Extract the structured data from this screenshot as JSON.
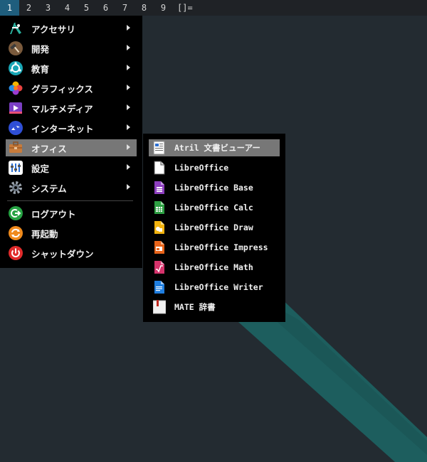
{
  "topbar": {
    "workspaces": [
      "1",
      "2",
      "3",
      "4",
      "5",
      "6",
      "7",
      "8",
      "9"
    ],
    "active_workspace": "1",
    "layout_symbol": "[]="
  },
  "menu": {
    "items": [
      {
        "label": "アクセサリ",
        "icon": "accessories-icon",
        "has_submenu": true
      },
      {
        "label": "開発",
        "icon": "development-hammer-icon",
        "has_submenu": true
      },
      {
        "label": "教育",
        "icon": "education-icon",
        "has_submenu": true
      },
      {
        "label": "グラフィックス",
        "icon": "graphics-icon",
        "has_submenu": true
      },
      {
        "label": "マルチメディア",
        "icon": "multimedia-icon",
        "has_submenu": true
      },
      {
        "label": "インターネット",
        "icon": "internet-icon",
        "has_submenu": true
      },
      {
        "label": "オフィス",
        "icon": "office-briefcase-icon",
        "has_submenu": true,
        "selected": true
      },
      {
        "label": "設定",
        "icon": "settings-icon",
        "has_submenu": true
      },
      {
        "label": "システム",
        "icon": "system-gear-icon",
        "has_submenu": true
      }
    ],
    "session_items": [
      {
        "label": "ログアウト",
        "icon": "logout-icon"
      },
      {
        "label": "再起動",
        "icon": "restart-icon"
      },
      {
        "label": "シャットダウン",
        "icon": "shutdown-icon"
      }
    ]
  },
  "submenu": {
    "items": [
      {
        "label": "Atril 文書ビューアー",
        "icon": "atril-document-viewer-icon",
        "selected": true
      },
      {
        "label": "LibreOffice",
        "icon": "libreoffice-icon"
      },
      {
        "label": "LibreOffice Base",
        "icon": "libreoffice-base-icon"
      },
      {
        "label": "LibreOffice Calc",
        "icon": "libreoffice-calc-icon"
      },
      {
        "label": "LibreOffice Draw",
        "icon": "libreoffice-draw-icon"
      },
      {
        "label": "LibreOffice Impress",
        "icon": "libreoffice-impress-icon"
      },
      {
        "label": "LibreOffice Math",
        "icon": "libreoffice-math-icon"
      },
      {
        "label": "LibreOffice Writer",
        "icon": "libreoffice-writer-icon"
      },
      {
        "label": "MATE 辞書",
        "icon": "mate-dictionary-icon"
      }
    ]
  },
  "colors": {
    "desktop_bg": "#232b31",
    "wallpaper_stripe": "#1d5e5e",
    "active_workspace": "#1f5e7d",
    "menu_bg": "#000000",
    "selected_item": "#777777"
  }
}
